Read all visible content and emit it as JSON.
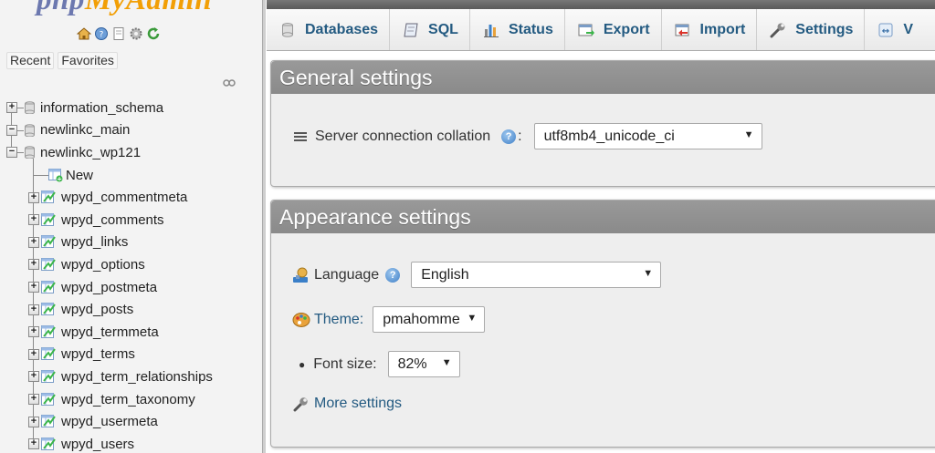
{
  "app": {
    "logo_main": "php",
    "logo_accent": "MyAdmin"
  },
  "nav": {
    "recent_label": "Recent",
    "favorites_label": "Favorites",
    "databases": [
      {
        "name": "information_schema",
        "state": "collapsed"
      },
      {
        "name": "newlinkc_main",
        "state": "expanded"
      },
      {
        "name": "newlinkc_wp121",
        "state": "expanded"
      }
    ],
    "new_label": "New",
    "tables": [
      "wpyd_commentmeta",
      "wpyd_comments",
      "wpyd_links",
      "wpyd_options",
      "wpyd_postmeta",
      "wpyd_posts",
      "wpyd_termmeta",
      "wpyd_terms",
      "wpyd_term_relationships",
      "wpyd_term_taxonomy",
      "wpyd_usermeta",
      "wpyd_users"
    ]
  },
  "tabs": [
    {
      "label": "Databases",
      "icon": "databases-icon"
    },
    {
      "label": "SQL",
      "icon": "sql-icon"
    },
    {
      "label": "Status",
      "icon": "status-icon"
    },
    {
      "label": "Export",
      "icon": "export-icon"
    },
    {
      "label": "Import",
      "icon": "import-icon"
    },
    {
      "label": "Settings",
      "icon": "wrench-icon"
    },
    {
      "label": "V",
      "icon": "variables-icon"
    }
  ],
  "general": {
    "title": "General settings",
    "collation_label": "Server connection collation",
    "collation_value": "utf8mb4_unicode_ci"
  },
  "appearance": {
    "title": "Appearance settings",
    "language_label": "Language",
    "language_value": "English",
    "theme_label": "Theme:",
    "theme_value": "pmahomme",
    "fontsize_label": "Font size:",
    "fontsize_value": "82%",
    "more_settings": "More settings"
  },
  "colors": {
    "accent_link": "#235a81",
    "panel_title_bg": "#8f8f8f",
    "logo_blue": "#6c78af",
    "logo_orange": "#f29f05"
  }
}
